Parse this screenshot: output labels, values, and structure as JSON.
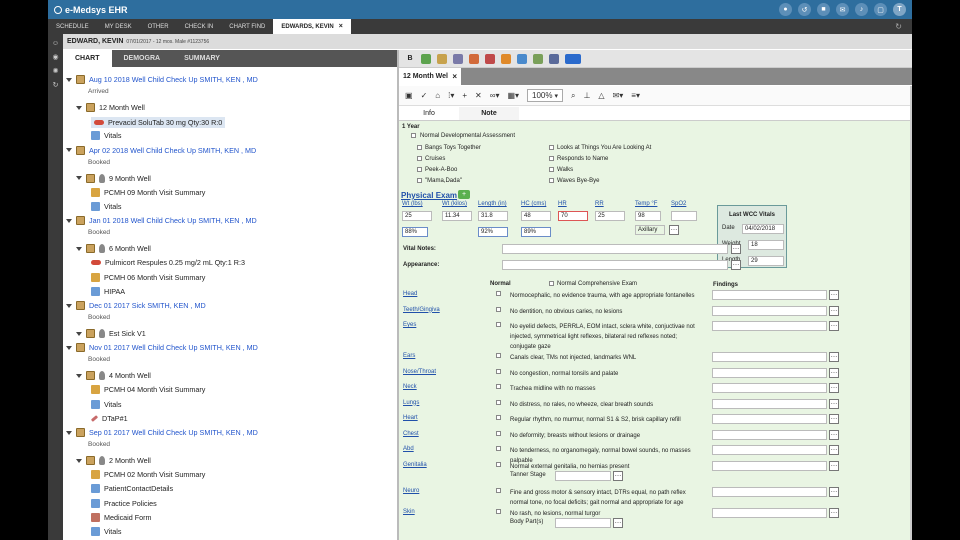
{
  "app": {
    "title": "e-Medsys EHR",
    "user_initial": "T"
  },
  "nav": {
    "tabs": [
      "SCHEDULE",
      "MY DESK",
      "OTHER",
      "CHECK IN",
      "CHART FIND"
    ],
    "patient_tab": "EDWARDS, KEVIN"
  },
  "patient": {
    "name": "EDWARD, KEVIN",
    "info": "07/01/2017 - 12 mos. Male #1123756"
  },
  "chart_tabs": [
    "CHART",
    "DEMOGRA",
    "SUMMARY"
  ],
  "tree": [
    {
      "t": "enc",
      "label": "Aug 10 2018 Well Child Check Up SMITH, KEN , MD",
      "status": "Arrived"
    },
    {
      "t": "visit",
      "label": "12 Month Well"
    },
    {
      "t": "rx",
      "label": "Prevacid SoluTab 30 mg Qty:30 R:0",
      "sel": true
    },
    {
      "t": "vitals",
      "label": "Vitals"
    },
    {
      "t": "enc",
      "label": "Apr 02 2018 Well Child Check Up SMITH, KEN , MD",
      "status": "Booked"
    },
    {
      "t": "visit2",
      "label": "9 Month Well"
    },
    {
      "t": "doc",
      "label": "PCMH 09 Month Visit Summary"
    },
    {
      "t": "vitals",
      "label": "Vitals"
    },
    {
      "t": "enc",
      "label": "Jan 01 2018 Well Child Check Up SMITH, KEN , MD",
      "status": "Booked"
    },
    {
      "t": "visit2",
      "label": "6 Month Well"
    },
    {
      "t": "rx",
      "label": "Pulmicort Respules 0.25 mg/2 mL Qty:1 R:3"
    },
    {
      "t": "doc",
      "label": "PCMH 06 Month Visit Summary"
    },
    {
      "t": "vitals2",
      "label": "HIPAA"
    },
    {
      "t": "enc",
      "label": "Dec 01 2017 Sick SMITH, KEN , MD",
      "status": "Booked"
    },
    {
      "t": "visit3",
      "label": "Est Sick V1"
    },
    {
      "t": "enc",
      "label": "Nov 01 2017 Well Child Check Up SMITH, KEN , MD",
      "status": "Booked"
    },
    {
      "t": "visit2",
      "label": "4 Month Well"
    },
    {
      "t": "doc",
      "label": "PCMH 04 Month Visit Summary"
    },
    {
      "t": "vitals",
      "label": "Vitals"
    },
    {
      "t": "shot",
      "label": "DTaP#1"
    },
    {
      "t": "enc",
      "label": "Sep 01 2017 Well Child Check Up SMITH, KEN , MD",
      "status": "Booked"
    },
    {
      "t": "visit2",
      "label": "2 Month Well"
    },
    {
      "t": "doc",
      "label": "PCMH 02 Month Visit Summary"
    },
    {
      "t": "vitals",
      "label": "PatientContactDetails"
    },
    {
      "t": "vitals",
      "label": "Practice Policies"
    },
    {
      "t": "med",
      "label": "Medicaid Form"
    },
    {
      "t": "vitals",
      "label": "Vitals"
    }
  ],
  "note": {
    "tab": "12 Month Wel",
    "zoom": "100%",
    "subtabs": [
      "Info",
      "Note"
    ]
  },
  "form": {
    "year": "1 Year",
    "dev": "Normal Developmental Assessment",
    "dev_left": [
      "Bangs Toys Together",
      "Cruises",
      "Peek-A-Boo",
      "\"Mama,Dada\""
    ],
    "dev_right": [
      "Looks at Things You Are Looking At",
      "Responds to Name",
      "Walks",
      "Waves Bye-Bye"
    ],
    "pe_title": "Physical Exam",
    "vitals_labels": [
      "Wt (lbs)",
      "Wt (kilos)",
      "Length (in)",
      "HC (cms)",
      "HR",
      "RR",
      "Temp °F",
      "SpO2"
    ],
    "vitals_values": [
      "25",
      "11.34",
      "31.8",
      "48",
      "70",
      "25",
      "98",
      ""
    ],
    "pct_values": [
      "88%",
      "",
      "92%",
      "89%"
    ],
    "temp_method": "Axillary",
    "wcc": {
      "title": "Last WCC Vitals",
      "date_label": "Date",
      "date": "04/02/2018",
      "weight_label": "Weight",
      "weight": "18",
      "length_label": "Length",
      "length": "29"
    },
    "vital_notes": "Vital Notes:",
    "appearance": "Appearance:",
    "normal_col": "Normal",
    "normal_comp": "Normal Comprehensive Exam",
    "findings_col": "Findings",
    "exam": [
      {
        "n": "Head",
        "d": "Normocephalic, no evidence trauma, with age appropriate fontanelles"
      },
      {
        "n": "Teeth/Gingiva",
        "d": "No dentition, no obvious caries, no lesions"
      },
      {
        "n": "Eyes",
        "d": "No eyelid defects, PERRLA, EOM intact, sclera white, conjuctivae not injected, symmetrical light reflexes, bilateral red reflexes noted; conjugate gaze"
      },
      {
        "n": "Ears",
        "d": "Canals clear, TMs not injected, landmarks WNL"
      },
      {
        "n": "Nose/Throat",
        "d": "No congestion, normal tonsils and palate"
      },
      {
        "n": "Neck",
        "d": "Trachea midline with no masses"
      },
      {
        "n": "Lungs",
        "d": "No distress, no rales, no wheeze, clear breath sounds"
      },
      {
        "n": "Heart",
        "d": "Regular rhythm, no murmur, normal S1 & S2, brisk capillary refill"
      },
      {
        "n": "Chest",
        "d": "No deformity; breasts without lesions or drainage"
      },
      {
        "n": "Abd",
        "d": "No tenderness, no organomegaly, normal bowel sounds, no masses palpable"
      },
      {
        "n": "Genitalia",
        "d": "Normal external genitalia, no hernias present",
        "sub": "Tanner Stage"
      },
      {
        "n": "Neuro",
        "d": "Fine and gross motor & sensory intact, DTRs equal, no path reflex normal tone, no focal deficits; gait normal and appropriate for age"
      },
      {
        "n": "Skin",
        "d": "No rash, no lesions, normal turgor",
        "sub": "Body Part(s)"
      }
    ]
  }
}
